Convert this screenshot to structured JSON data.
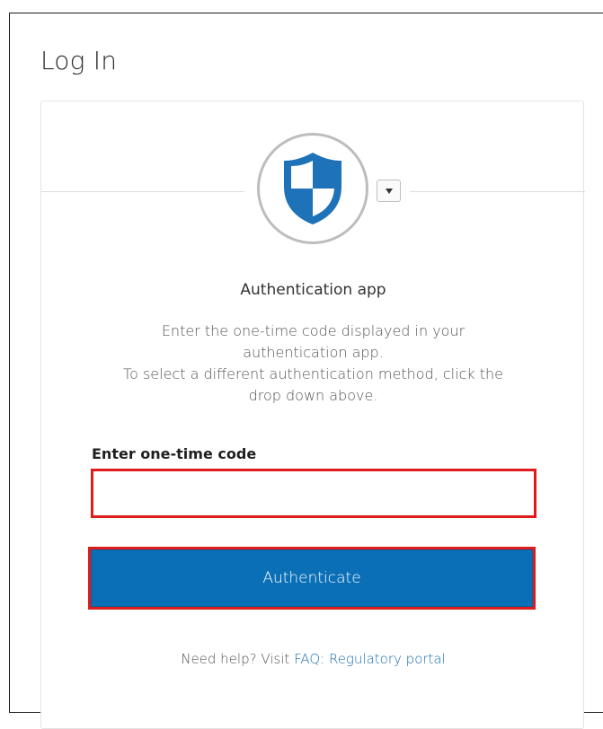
{
  "page": {
    "title": "Log In"
  },
  "factor": {
    "icon": "shield-icon",
    "heading": "Authentication app",
    "instructions": [
      "Enter the one-time code displayed in your",
      "authentication app.",
      "To select a different authentication method, click the",
      "drop down above."
    ]
  },
  "form": {
    "code_label": "Enter one-time code",
    "code_value": "",
    "submit_label": "Authenticate"
  },
  "help": {
    "prefix": "Need help? Visit ",
    "link_text": "FAQ: Regulatory portal"
  },
  "colors": {
    "primary": "#0a6fb6",
    "highlight": "#e01b1b",
    "shield_blue": "#1d72b8"
  }
}
